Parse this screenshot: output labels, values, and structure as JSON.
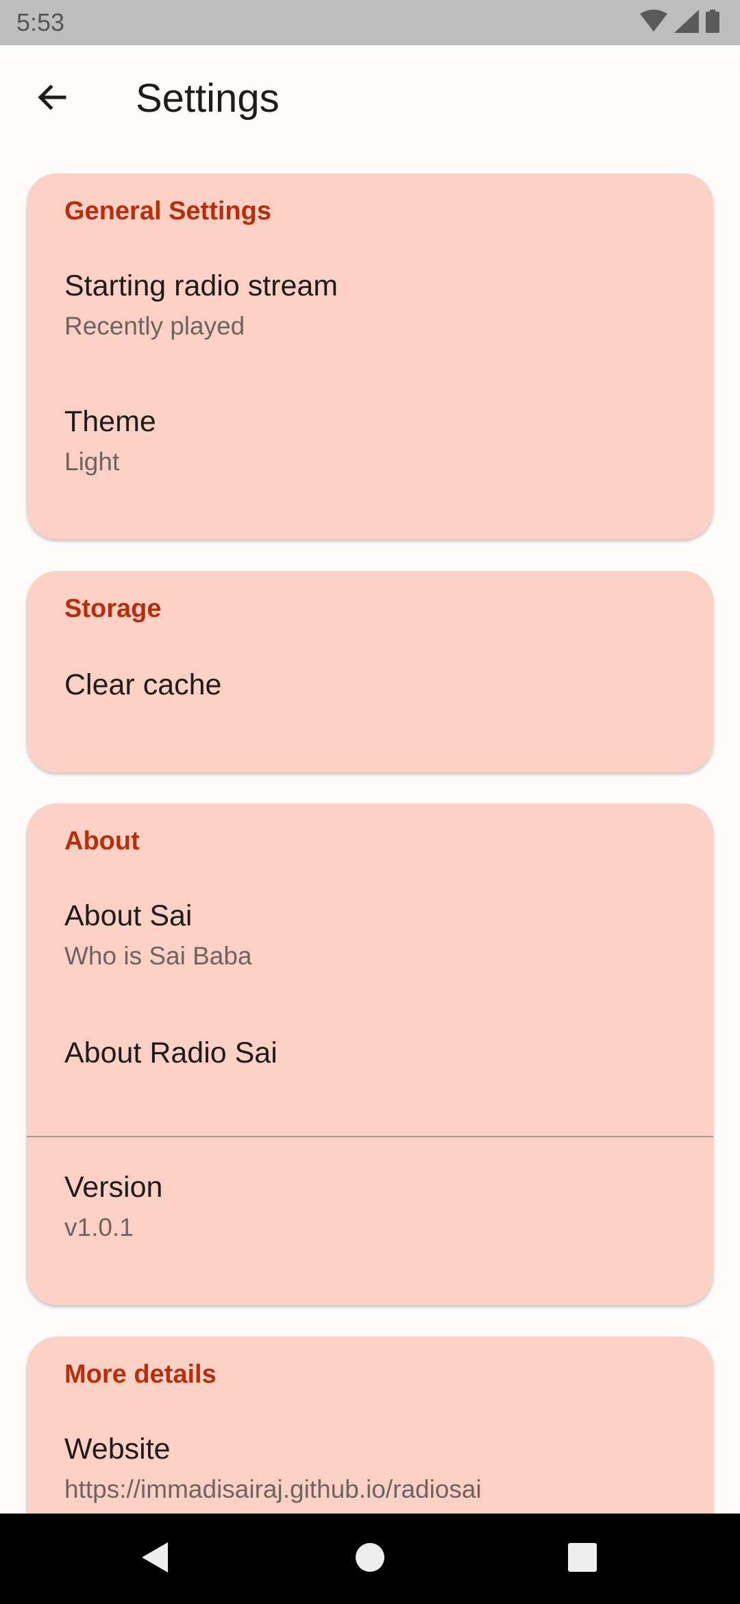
{
  "status_bar": {
    "time": "5:53",
    "icons": [
      "wifi-icon",
      "signal-icon",
      "battery-icon"
    ]
  },
  "app_bar": {
    "title": "Settings",
    "back_icon": "arrow-back-icon"
  },
  "colors": {
    "card_background": "#fbd1c5",
    "section_header": "#b82e0b",
    "status_bar": "#bdbdbd",
    "navigation_bar": "#000000"
  },
  "sections": {
    "general": {
      "header": "General Settings",
      "starting_stream_title": "Starting radio stream",
      "starting_stream_value": "Recently played",
      "theme_title": "Theme",
      "theme_value": "Light"
    },
    "storage": {
      "header": "Storage",
      "clear_cache_title": "Clear cache"
    },
    "about": {
      "header": "About",
      "about_sai_title": "About Sai",
      "about_sai_subtitle": "Who is Sai Baba",
      "about_radio_title": "About Radio Sai",
      "version_title": "Version",
      "version_value": "v1.0.1"
    },
    "more_details": {
      "header": "More details",
      "website_title": "Website",
      "website_url": "https://immadisairaj.github.io/radiosai"
    }
  },
  "navigation_bar": {
    "icons": [
      "nav-back-icon",
      "nav-home-icon",
      "nav-recents-icon"
    ]
  }
}
